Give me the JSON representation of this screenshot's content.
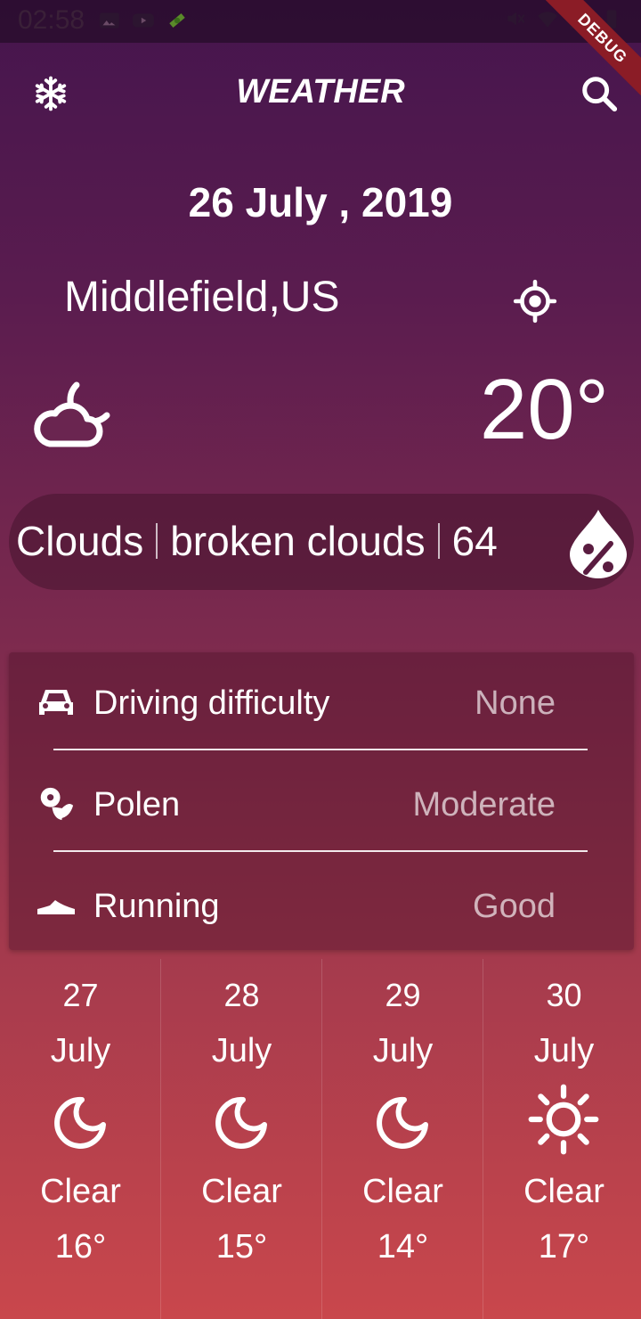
{
  "status_bar": {
    "time": "02:58",
    "debug_banner": "DEBUG"
  },
  "app_bar": {
    "title": "WEATHER",
    "left_icon": "snowflake-icon",
    "right_icon": "search-icon"
  },
  "current": {
    "date": "26 July , 2019",
    "city": "Middlefield,US",
    "temperature": "20°",
    "icon": "cloud-moon-icon",
    "condition_main": "Clouds",
    "condition_description": "broken clouds",
    "humidity": "64"
  },
  "activities": [
    {
      "icon": "car-icon",
      "label": "Driving difficulty",
      "value": "None"
    },
    {
      "icon": "flower-icon",
      "label": "Polen",
      "value": "Moderate"
    },
    {
      "icon": "shoe-icon",
      "label": "Running",
      "value": "Good"
    }
  ],
  "forecast": [
    {
      "day": "27",
      "month": "July",
      "icon": "moon-icon",
      "condition": "Clear",
      "temp": "16°"
    },
    {
      "day": "28",
      "month": "July",
      "icon": "moon-icon",
      "condition": "Clear",
      "temp": "15°"
    },
    {
      "day": "29",
      "month": "July",
      "icon": "moon-icon",
      "condition": "Clear",
      "temp": "14°"
    },
    {
      "day": "30",
      "month": "July",
      "icon": "sun-icon",
      "condition": "Clear",
      "temp": "17°"
    }
  ],
  "colors": {
    "gradient_top": "#45154d",
    "gradient_bottom": "#c9474c",
    "debug_banner": "#8b1c26"
  }
}
